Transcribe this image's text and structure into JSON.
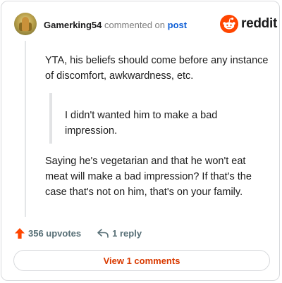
{
  "header": {
    "username": "Gamerking54",
    "action_text": "commented on",
    "link_text": "post"
  },
  "brand": {
    "name": "reddit",
    "logo_icon": "reddit-snoo-icon",
    "color": "#ff4500"
  },
  "comment": {
    "paragraph_1": "YTA, his beliefs should come before any instance of discomfort, awkwardness, etc.",
    "quote": "I didn't wanted him to make a bad impression.",
    "paragraph_2": "Saying he's vegetarian and that he won't eat meat will make a bad impression? If that's the case that's not on him, that's on your family."
  },
  "actions": {
    "upvotes_label": "356 upvotes",
    "upvote_icon": "upvote-arrow-icon",
    "reply_label": "1 reply",
    "reply_icon": "reply-arrow-icon"
  },
  "footer": {
    "view_comments_label": "View 1 comments"
  },
  "colors": {
    "accent": "#d93a00",
    "link": "#0f5fd6",
    "upvote": "#ff4500"
  }
}
